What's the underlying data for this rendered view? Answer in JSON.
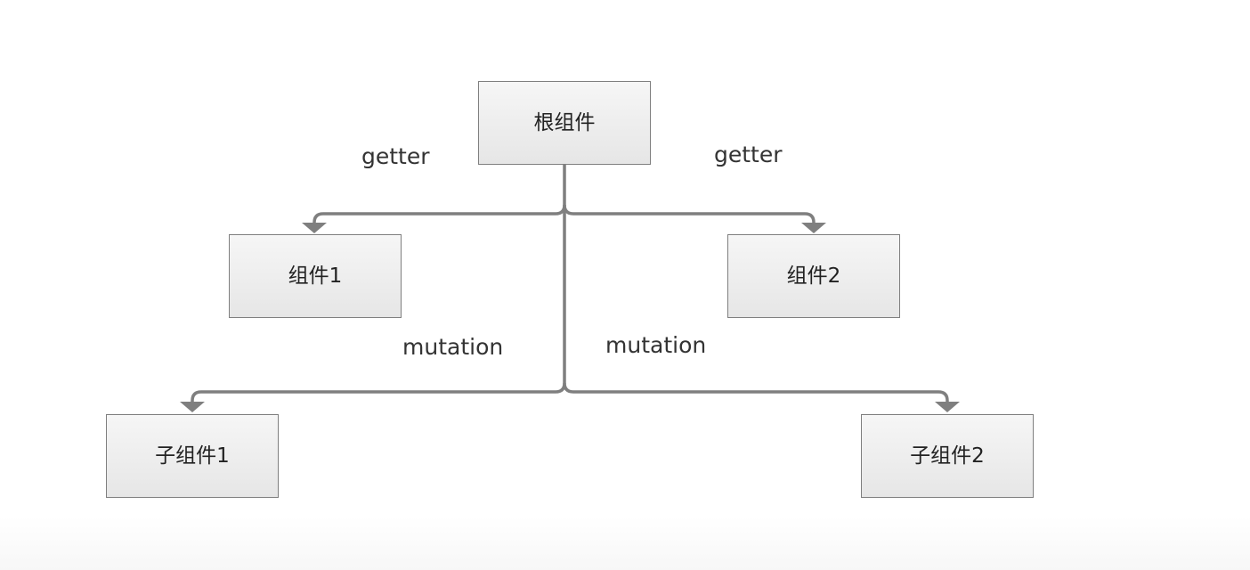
{
  "diagram": {
    "nodes": {
      "root": "根组件",
      "component1": "组件1",
      "component2": "组件2",
      "sub_component1": "子组件1",
      "sub_component2": "子组件2"
    },
    "edge_labels": {
      "getter_left": "getter",
      "getter_right": "getter",
      "mutation_left": "mutation",
      "mutation_right": "mutation"
    },
    "colors": {
      "connector": "#7f7f7f",
      "node_border": "#7f7f7f",
      "node_fill_top": "#f6f6f6",
      "node_fill_bottom": "#e6e6e6",
      "text": "#222222"
    }
  }
}
